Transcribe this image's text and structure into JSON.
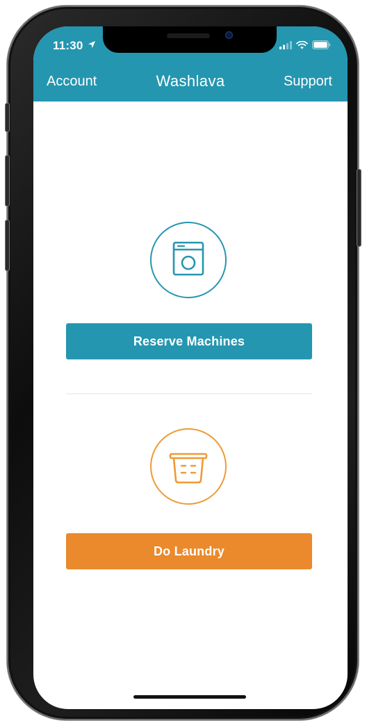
{
  "status_bar": {
    "time": "11:30",
    "location_icon": "location-arrow-icon",
    "signal_icon": "cellular-signal-icon",
    "wifi_icon": "wifi-icon",
    "battery_icon": "battery-icon"
  },
  "nav": {
    "left": "Account",
    "title": "Washlava",
    "right": "Support"
  },
  "actions": {
    "reserve": {
      "icon": "washing-machine-icon",
      "label": "Reserve Machines"
    },
    "laundry": {
      "icon": "laundry-basket-icon",
      "label": "Do Laundry"
    }
  },
  "colors": {
    "primary": "#2496b0",
    "accent": "#ea8a2d",
    "background": "#ffffff"
  }
}
